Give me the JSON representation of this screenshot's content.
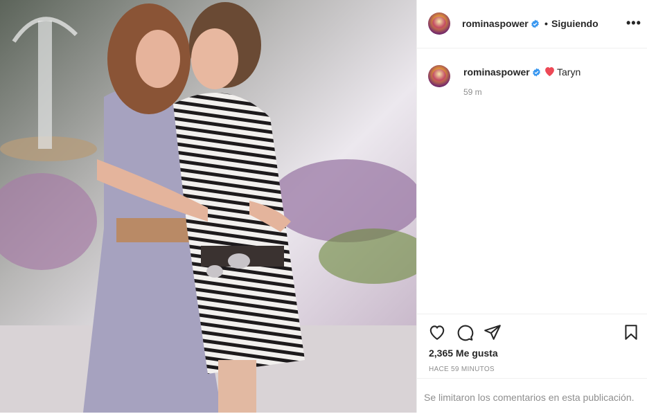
{
  "post": {
    "image_alt": "Two women embracing in front of a fountain and purple flowers",
    "author": {
      "username": "rominaspower",
      "verified": true,
      "follow_status": "Siguiendo"
    },
    "caption": {
      "username": "rominaspower",
      "emoji": "heart",
      "text": "Taryn",
      "time": "59 m"
    },
    "actions": {
      "like_icon": "heart-outline-icon",
      "comment_icon": "comment-bubble-icon",
      "share_icon": "paper-plane-icon",
      "save_icon": "bookmark-icon"
    },
    "likes": "2,365 Me gusta",
    "time_ago": "HACE 59 MINUTOS",
    "comments_notice": "Se limitaron los comentarios en esta publicación."
  },
  "colors": {
    "verified_blue": "#3897f0",
    "heart_red": "#ed4956",
    "text_primary": "#262626",
    "text_secondary": "#8e8e8e",
    "divider": "#efefef"
  }
}
